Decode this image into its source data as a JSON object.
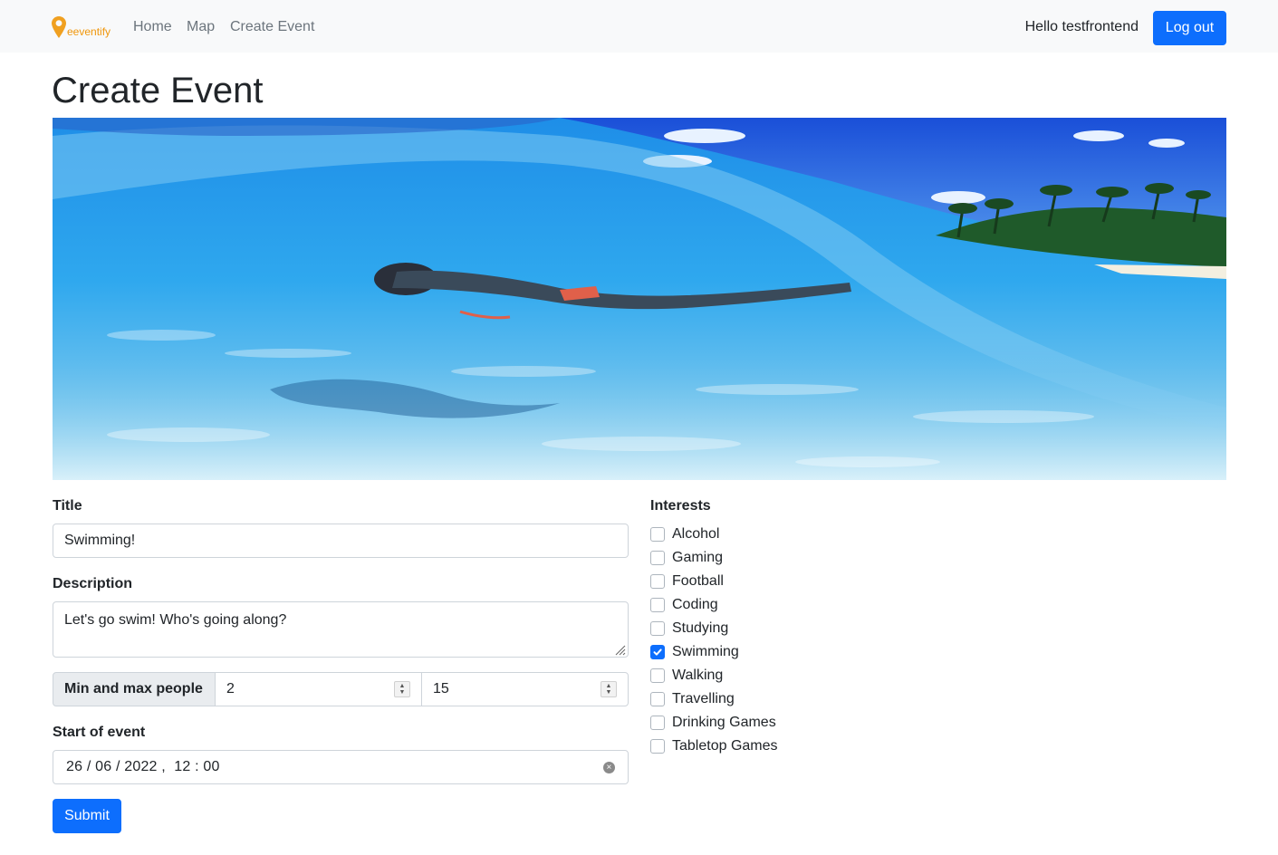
{
  "navbar": {
    "brand": "eeventify",
    "links": [
      "Home",
      "Map",
      "Create Event"
    ],
    "greeting": "Hello testfrontend",
    "logout_label": "Log out",
    "brand_color": "#f0960a"
  },
  "page": {
    "title": "Create Event"
  },
  "form": {
    "title_label": "Title",
    "title_value": "Swimming!",
    "description_label": "Description",
    "description_value": "Let's go swim! Who's going along?",
    "people_label": "Min and max people",
    "min_people": "2",
    "max_people": "15",
    "start_label": "Start of event",
    "start_value": "26 / 06 / 2022 ,  12 : 00",
    "submit_label": "Submit"
  },
  "interests": {
    "label": "Interests",
    "items": [
      {
        "label": "Alcohol",
        "checked": false
      },
      {
        "label": "Gaming",
        "checked": false
      },
      {
        "label": "Football",
        "checked": false
      },
      {
        "label": "Coding",
        "checked": false
      },
      {
        "label": "Studying",
        "checked": false
      },
      {
        "label": "Swimming",
        "checked": true
      },
      {
        "label": "Walking",
        "checked": false
      },
      {
        "label": "Travelling",
        "checked": false
      },
      {
        "label": "Drinking Games",
        "checked": false
      },
      {
        "label": "Tabletop Games",
        "checked": false
      }
    ]
  },
  "colors": {
    "primary": "#0d6efd",
    "navbar_bg": "#f8f9fa"
  }
}
